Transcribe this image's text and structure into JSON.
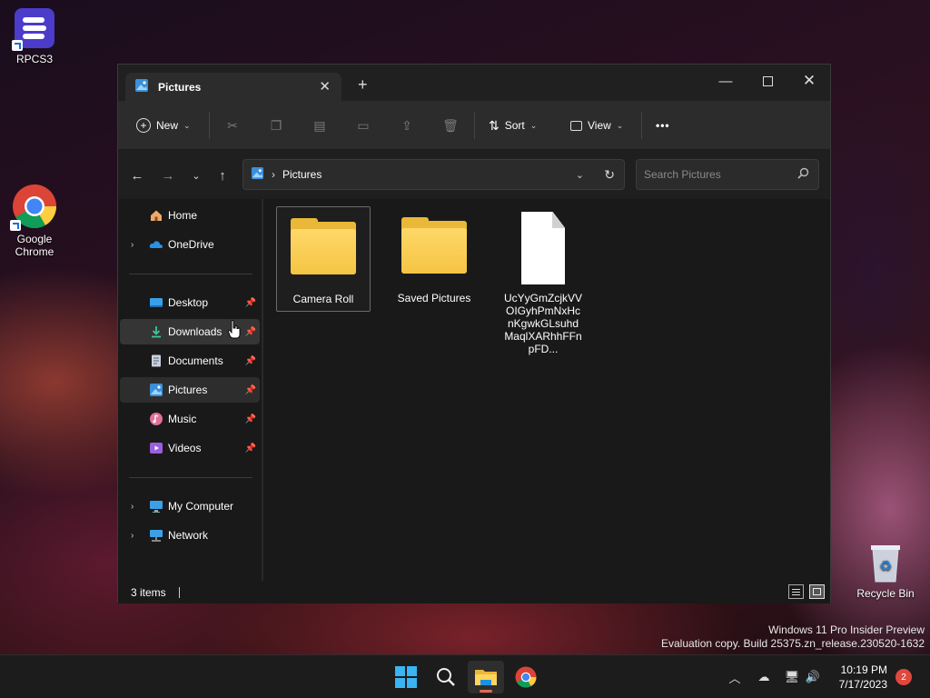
{
  "desktop": {
    "icons": [
      {
        "label": "RPCS3",
        "icon": "rpcs3-icon"
      },
      {
        "label": "Google Chrome",
        "icon": "chrome-icon"
      },
      {
        "label": "Recycle Bin",
        "icon": "recycle-bin-icon"
      }
    ],
    "watermark_line1": "Windows 11 Pro Insider Preview",
    "watermark_line2": "Evaluation copy. Build 25375.zn_release.230520-1632"
  },
  "window": {
    "tab_title": "Pictures",
    "toolbar": {
      "new_label": "New",
      "sort_label": "Sort",
      "view_label": "View",
      "more_label": "•••"
    },
    "address": {
      "path": "Pictures",
      "separator": "›"
    },
    "search": {
      "placeholder": "Search Pictures"
    },
    "sidebar": {
      "items": [
        {
          "label": "Home",
          "icon": "home-icon"
        },
        {
          "label": "OneDrive",
          "icon": "onedrive-icon"
        },
        {
          "label": "Desktop",
          "icon": "desktop-icon",
          "pinned": true
        },
        {
          "label": "Downloads",
          "icon": "download-icon",
          "pinned": true
        },
        {
          "label": "Documents",
          "icon": "documents-icon",
          "pinned": true
        },
        {
          "label": "Pictures",
          "icon": "pictures-icon",
          "pinned": true
        },
        {
          "label": "Music",
          "icon": "music-icon",
          "pinned": true
        },
        {
          "label": "Videos",
          "icon": "videos-icon",
          "pinned": true
        },
        {
          "label": "My Computer",
          "icon": "computer-icon"
        },
        {
          "label": "Network",
          "icon": "network-icon"
        }
      ]
    },
    "files": [
      {
        "name": "Camera Roll",
        "type": "folder"
      },
      {
        "name": "Saved Pictures",
        "type": "folder"
      },
      {
        "name": "UcYyGmZcjkVVOIGyhPmNxHcnKgwkGLsuhdMaqlXARhhFFnpFD...",
        "type": "file"
      }
    ],
    "status": {
      "items_count": "3 items"
    }
  },
  "taskbar": {
    "time": "10:19 PM",
    "date": "7/17/2023",
    "notification_count": "2"
  },
  "colors": {
    "accent": "#0067c0",
    "folder": "#f5c443",
    "taskbar_indicator": "#e06b4e",
    "notification": "#e0483e"
  }
}
